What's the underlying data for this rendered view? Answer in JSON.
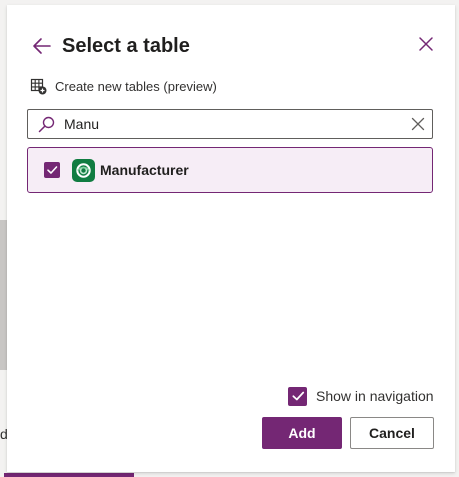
{
  "dialog": {
    "title": "Select a table",
    "back_icon": "arrow-left-icon",
    "close_icon": "close-icon",
    "create_link": {
      "label": "Create new tables (preview)",
      "icon": "table-add-icon"
    }
  },
  "search": {
    "value": "Manu",
    "icon": "search-icon",
    "clear_icon": "clear-icon"
  },
  "results": [
    {
      "label": "Manufacturer",
      "checked": true,
      "icon": "dataverse-table-icon"
    }
  ],
  "options": {
    "show_in_navigation": {
      "label": "Show in navigation",
      "checked": true
    }
  },
  "actions": {
    "add_label": "Add",
    "cancel_label": "Cancel"
  },
  "background": {
    "partial_letter": "d"
  },
  "colors": {
    "accent": "#742774",
    "selected_row_bg": "#f6edf6",
    "table_icon_bg": "#107c41"
  }
}
